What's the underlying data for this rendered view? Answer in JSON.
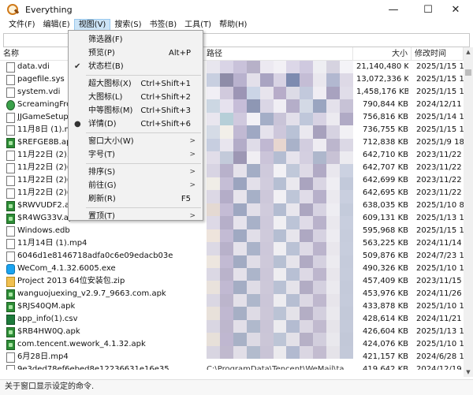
{
  "window": {
    "title": "Everything",
    "minimize_glyph": "—",
    "maximize_glyph": "☐",
    "close_glyph": "✕"
  },
  "menubar": [
    {
      "label": "文件(F)",
      "active": false
    },
    {
      "label": "编辑(E)",
      "active": false
    },
    {
      "label": "视图(V)",
      "active": true
    },
    {
      "label": "搜索(S)",
      "active": false
    },
    {
      "label": "书签(B)",
      "active": false
    },
    {
      "label": "工具(T)",
      "active": false
    },
    {
      "label": "帮助(H)",
      "active": false
    }
  ],
  "columns": {
    "name": "名称",
    "path": "路径",
    "size": "大小",
    "date": "修改时间"
  },
  "view_menu": {
    "items": [
      {
        "label": "筛选器(F)",
        "shortcut": "",
        "mark": "",
        "submenu": false
      },
      {
        "label": "预览(P)",
        "shortcut": "Alt+P",
        "mark": "",
        "submenu": false
      },
      {
        "label": "状态栏(B)",
        "shortcut": "",
        "mark": "✔",
        "submenu": false,
        "sep_after": true
      },
      {
        "label": "超大图标(X)",
        "shortcut": "Ctrl+Shift+1",
        "mark": "",
        "submenu": false
      },
      {
        "label": "大图标(L)",
        "shortcut": "Ctrl+Shift+2",
        "mark": "",
        "submenu": false
      },
      {
        "label": "中等图标(M)",
        "shortcut": "Ctrl+Shift+3",
        "mark": "",
        "submenu": false
      },
      {
        "label": "详情(D)",
        "shortcut": "Ctrl+Shift+6",
        "mark": "●",
        "submenu": false,
        "sep_after": true
      },
      {
        "label": "窗口大小(W)",
        "shortcut": "",
        "mark": "",
        "submenu": true
      },
      {
        "label": "字号(T)",
        "shortcut": "",
        "mark": "",
        "submenu": true,
        "sep_after": true
      },
      {
        "label": "排序(S)",
        "shortcut": "",
        "mark": "",
        "submenu": true
      },
      {
        "label": "前往(G)",
        "shortcut": "",
        "mark": "",
        "submenu": true
      },
      {
        "label": "刷新(R)",
        "shortcut": "F5",
        "mark": "",
        "submenu": false,
        "sep_after": true
      },
      {
        "label": "置顶(T)",
        "shortcut": "",
        "mark": "",
        "submenu": true
      }
    ],
    "submenu_arrow": ">"
  },
  "files": [
    {
      "name": "data.vdi",
      "icon": "doc-icon",
      "kind": "doc",
      "size": "21,140,480 KB",
      "date": "2025/1/15 12"
    },
    {
      "name": "pagefile.sys",
      "icon": "doc-icon",
      "kind": "doc",
      "size": "13,072,336 KB",
      "date": "2025/1/15 12"
    },
    {
      "name": "system.vdi",
      "icon": "doc-icon",
      "kind": "doc",
      "size": "1,458,176 KB",
      "date": "2025/1/15 11"
    },
    {
      "name": "ScreamingFrog",
      "icon": "frog-icon",
      "kind": "frog",
      "size": "790,844 KB",
      "date": "2024/12/11 1"
    },
    {
      "name": "JJGameSetup_",
      "icon": "doc-icon",
      "kind": "doc",
      "size": "756,816 KB",
      "date": "2025/1/14 18"
    },
    {
      "name": "11月8日 (1).mp",
      "icon": "doc-icon",
      "kind": "doc",
      "size": "736,755 KB",
      "date": "2025/1/15 11"
    },
    {
      "name": "$REFGE8B.apk",
      "icon": "apk-icon",
      "kind": "apk",
      "size": "712,838 KB",
      "date": "2025/1/9 18:"
    },
    {
      "name": "11月22日 (2).m",
      "icon": "doc-icon",
      "kind": "doc",
      "size": "642,710 KB",
      "date": "2023/11/22 1"
    },
    {
      "name": "11月22日 (2)(1",
      "icon": "doc-icon",
      "kind": "doc",
      "size": "642,707 KB",
      "date": "2023/11/22 1"
    },
    {
      "name": "11月22日 (2)(3",
      "icon": "doc-icon",
      "kind": "doc",
      "size": "642,699 KB",
      "date": "2023/11/22 1"
    },
    {
      "name": "11月22日 (2)(2",
      "icon": "doc-icon",
      "kind": "doc",
      "size": "642,695 KB",
      "date": "2023/11/22 1"
    },
    {
      "name": "$RWVUDF2.apk",
      "icon": "apk-icon",
      "kind": "apk",
      "size": "638,035 KB",
      "date": "2025/1/10 8:"
    },
    {
      "name": "$R4WG33V.apk",
      "icon": "apk-icon",
      "kind": "apk",
      "size": "609,131 KB",
      "date": "2025/1/13 18"
    },
    {
      "name": "Windows.edb",
      "icon": "doc-icon",
      "kind": "doc",
      "size": "595,968 KB",
      "date": "2025/1/15 12"
    },
    {
      "name": "11月14日 (1).mp4",
      "icon": "doc-icon",
      "kind": "doc",
      "size": "563,225 KB",
      "date": "2024/11/14 1"
    },
    {
      "name": "6046d1e8146718adfa0c6e09edacb03e",
      "icon": "doc-icon",
      "kind": "doc",
      "size": "509,876 KB",
      "date": "2024/7/23 17"
    },
    {
      "name": "WeCom_4.1.32.6005.exe",
      "icon": "wecom-icon",
      "kind": "wc",
      "size": "490,326 KB",
      "date": "2025/1/10 15"
    },
    {
      "name": "Project 2013 64位安装包.zip",
      "icon": "zip-icon",
      "kind": "zip",
      "size": "457,409 KB",
      "date": "2023/11/15 1"
    },
    {
      "name": "wanguojuexing_v2.9.7_9663.com.apk",
      "icon": "apk-icon",
      "kind": "apk",
      "size": "453,976 KB",
      "date": "2024/11/26 1"
    },
    {
      "name": "$RJS40QM.apk",
      "icon": "apk-icon",
      "kind": "apk",
      "size": "433,878 KB",
      "date": "2025/1/10 18"
    },
    {
      "name": "app_info(1).csv",
      "icon": "csv-icon",
      "kind": "csv",
      "size": "428,614 KB",
      "date": "2024/11/21 1"
    },
    {
      "name": "$RB4HW0Q.apk",
      "icon": "apk-icon",
      "kind": "apk",
      "size": "426,604 KB",
      "date": "2025/1/13 18"
    },
    {
      "name": "com.tencent.wework_4.1.32.apk",
      "icon": "apk-icon",
      "kind": "apk",
      "size": "424,076 KB",
      "date": "2025/1/10 15"
    },
    {
      "name": "6月28日.mp4",
      "icon": "doc-icon",
      "kind": "doc",
      "size": "421,157 KB",
      "date": "2024/6/28 15"
    },
    {
      "name": "9e3ded78ef6ebed8e12236631e16e35",
      "icon": "doc-icon",
      "kind": "doc",
      "path": "C:\\ProgramData\\Tencent\\WeMail\\ta",
      "size": "419,642 KB",
      "date": "2024/12/19 1"
    }
  ],
  "statusbar": {
    "text": "关于窗口显示设定的命令."
  },
  "mosaic_colors": [
    "#e8e6ee",
    "#d9d4e6",
    "#c9c2da",
    "#b7b1c8",
    "#ece9f1",
    "#f2f0f5",
    "#dcd7e8",
    "#cfc9df",
    "#eeeef2",
    "#d6d3e0",
    "#f4f3f7",
    "#c8cfe0",
    "#8e8ca8",
    "#b9b2ce",
    "#e3e0ea",
    "#a9a4c2",
    "#d8d3e4",
    "#7d8bb0",
    "#c4bdd5",
    "#e9e7ee",
    "#b2b8d0",
    "#ddd9e6",
    "#f1eff5",
    "#d1cadd",
    "#9c95b5",
    "#cbd5e6",
    "#e7e4ed",
    "#b7acc9",
    "#dcdbe6",
    "#c2c9dc",
    "#efedf3",
    "#a8a2bf",
    "#e0dde9",
    "#ccd7e3",
    "#e6e2ee",
    "#c6bdd8",
    "#8e97b4",
    "#dad6e5",
    "#f0eef4",
    "#b5aec9",
    "#d3d9e5",
    "#9aa5c0",
    "#e4e1eb",
    "#c7c2d6",
    "#e9e6ef",
    "#b6cfd8",
    "#d0c9de",
    "#f3f1f6",
    "#a4aec7",
    "#c9c4d8",
    "#e2dfea",
    "#bfc7da",
    "#d7d2e3",
    "#eceaf0",
    "#b0aac5",
    "#d5dbe6",
    "#f2efe9",
    "#c1b9d3",
    "#9fa8c3",
    "#e5e2ec",
    "#cdc7db",
    "#b9c2d6",
    "#eae8ef",
    "#a7a1bd",
    "#d6d2e1",
    "#f1f0f4",
    "#c7cee0",
    "#e8e5ee",
    "#b3acc8",
    "#dfdce8",
    "#c0b8d2",
    "#e7d6cf",
    "#a9b2c9",
    "#d2cddf",
    "#eeecf2",
    "#bcb6cd",
    "#dbd8e5",
    "#e1dde9",
    "#c3cada",
    "#9d97b4",
    "#f0eef3",
    "#cbc4d9",
    "#b4bdd2",
    "#e6e3ec",
    "#d4cfe0",
    "#aeb7cc",
    "#c8c2d5",
    "#ecebf0",
    "#d8d4e3",
    "#b8b1cb",
    "#e5e2eb",
    "#a3adc5",
    "#cfcadc",
    "#f2f1f5",
    "#c0c8d9",
    "#dedae6",
    "#b1aac5",
    "#e9e7ee",
    "#cbd1e1",
    "#f0ede7",
    "#c5bed6",
    "#9ba4bf",
    "#e3e0ea",
    "#d1ccdd",
    "#b6bfd3",
    "#eae8ee",
    "#aaa4bf",
    "#d9d5e3",
    "#efeef3",
    "#c2c9da",
    "#dcd8e5",
    "#b4adc8",
    "#e7e4ec",
    "#a6b0c7",
    "#cdc8da",
    "#f1f0f4",
    "#bec6d8",
    "#e0dce8",
    "#b7b0ca",
    "#ebe9ef",
    "#c9cfdf",
    "#e4d9d2",
    "#c4bcd5",
    "#9ea7c1",
    "#e2dfe9",
    "#d0cbdc",
    "#b3bcd1",
    "#e8e6ed",
    "#aca6c0",
    "#d7d3e2",
    "#eeedf2",
    "#c4cbdb",
    "#ddd9e6",
    "#b6afc9",
    "#e6e3ec",
    "#a8b1c8",
    "#cec9db",
    "#f0eff3",
    "#bcc4d7",
    "#dfdbe7",
    "#b9b2cb",
    "#eae8ee",
    "#c8cede",
    "#eee4dc",
    "#c3bbd4",
    "#a0a9c2",
    "#e1dee8",
    "#cfcadb",
    "#b5bed2",
    "#e7e5ec",
    "#aea8c2",
    "#d6d2e1",
    "#edecf1",
    "#c6ccdc",
    "#dcd9e5",
    "#b8b1ca",
    "#e5e2eb",
    "#aab3c9",
    "#cdc8da",
    "#efeef2",
    "#bac2d5",
    "#dedae6",
    "#bbb4cc",
    "#e9e7ed",
    "#c7cddd",
    "#ede6df",
    "#c2bad3",
    "#a2abc3",
    "#e0dde7",
    "#cec9da",
    "#b7c0d3",
    "#e6e4eb",
    "#b0aac3",
    "#d5d1e0",
    "#ecebf0",
    "#c5cbdb",
    "#dbd8e4",
    "#bab3cb",
    "#e4e1ea",
    "#acb5ca",
    "#ccc7d9",
    "#eeedf1",
    "#b8c0d4",
    "#ddd9e5",
    "#bdb6cd",
    "#e8e6ec",
    "#c6ccdc",
    "#e9e2dc",
    "#c1b9d2",
    "#a4adc4",
    "#dfdce6",
    "#cdc8d9",
    "#b9c1d4",
    "#e5e3ea",
    "#b2acc4",
    "#d4d0df",
    "#ebeaef",
    "#c4cada",
    "#dad7e3",
    "#bcb5cc",
    "#e3e0e9",
    "#aeb7cb",
    "#cbc6d8",
    "#edecf0",
    "#b6bed2",
    "#dcd8e4",
    "#bfb8ce",
    "#e7e5eb",
    "#c5cbdb",
    "#e8e1da",
    "#c0b8d1",
    "#a6afc5",
    "#dedbe5",
    "#ccc7d8",
    "#bbc3d5",
    "#e4e2e9",
    "#b4aec5",
    "#d3cfde",
    "#eae9ee",
    "#c3c9d9",
    "#d9d6e2",
    "#beb7cd",
    "#e2dfe8",
    "#b0b9cc",
    "#cac5d7",
    "#ecebef",
    "#b4bcd1",
    "#dbd7e3",
    "#c1bacf",
    "#e6e4ea",
    "#c4cada",
    "#e7e0d9",
    "#bfb7d0",
    "#a8b1c6",
    "#dddae4",
    "#cbc6d7",
    "#bdc5d6",
    "#e3e1e8",
    "#b6b0c6",
    "#d2cedd",
    "#e9e8ed",
    "#c2c8d8",
    "#d8d5e1",
    "#c0b9ce",
    "#e1dee7",
    "#b2bbcd",
    "#c9c4d6",
    "#ebeaee",
    "#b2bad0",
    "#dad6e2",
    "#c3bcd0",
    "#e5e3e9",
    "#c3c9d9"
  ]
}
